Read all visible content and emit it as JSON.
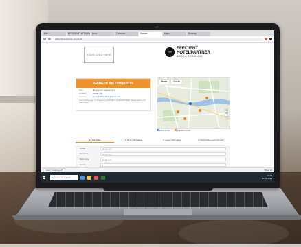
{
  "browser": {
    "tabs": [
      {
        "label": "Mail"
      },
      {
        "label": "EFFICIENT HOTELPARTNER"
      },
      {
        "label": "Docs"
      },
      {
        "label": "Calendar"
      },
      {
        "label": "Partner"
      },
      {
        "label": "Maps"
      },
      {
        "label": "Booking"
      }
    ],
    "url": "efficienthotelpartner.com/book"
  },
  "page": {
    "logo_placeholder": "YOUR LOGO HERE",
    "brand_mark": "EHP",
    "brand_line1": "EFFICIENT",
    "brand_line2": "HOTELPARTNER",
    "brand_tagline": "BOOK A ROOM LINK",
    "conference": {
      "title": "NAME of the conference",
      "rows": [
        {
          "key": "Date",
          "value": "dd.mm.yyyy - dd.mm.yyyy"
        },
        {
          "key": "Location",
          "value": "Venue, City"
        },
        {
          "key": "Contact",
          "value": "name@efficienthotelpartner.com"
        }
      ],
      "note": "This booking page is managed by EFFICIENT HOTELPARTNER. Please select your hotel below."
    },
    "map": {
      "tabs": [
        {
          "label": "Karte"
        },
        {
          "label": "Satellit"
        }
      ],
      "zoom_in": "+",
      "zoom_out": "−",
      "legend": [
        {
          "label": "Event venue",
          "color": "#2d6bd6"
        },
        {
          "label": "Available hotels",
          "color": "#e58a2a"
        }
      ]
    },
    "steps": [
      {
        "label": "1. Your hotel"
      },
      {
        "label": "2. Room and dates"
      },
      {
        "label": "3. Guest information"
      },
      {
        "label": "4. Registration and payment"
      }
    ],
    "form": [
      {
        "label": "Arrival",
        "placeholder": "dd.mm.yyyy"
      },
      {
        "label": "Departure",
        "placeholder": "dd.mm.yyyy"
      },
      {
        "label": "Room type",
        "placeholder": "Single room"
      },
      {
        "label": "Guests",
        "placeholder": "1"
      }
    ]
  },
  "downloads": {
    "item": "hotel_booking.pdf",
    "show_all": "Show all"
  },
  "taskbar": {
    "search": "Type here to search",
    "time": "14:25",
    "date": "10.06.2019"
  }
}
